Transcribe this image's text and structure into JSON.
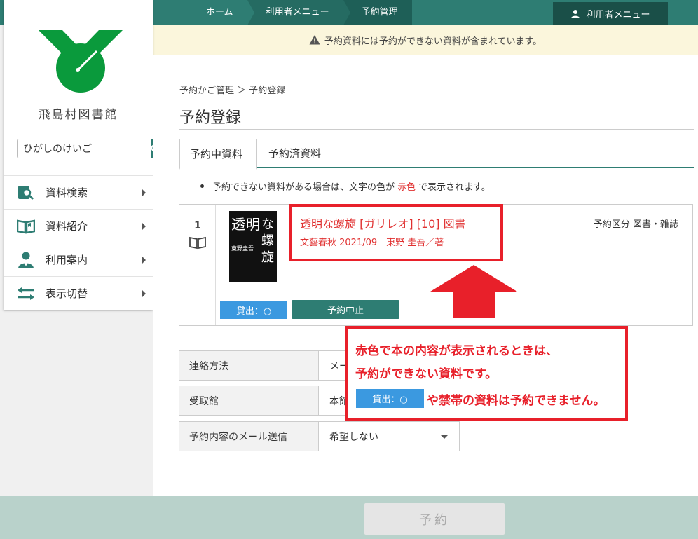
{
  "topbar": {
    "breadcrumbs": [
      "ホーム",
      "利用者メニュー",
      "予約管理"
    ],
    "user_menu_label": "利用者メニュー"
  },
  "warning": {
    "text": "予約資料には予約ができない資料が含まれています。"
  },
  "sidebar": {
    "library_name": "飛島村図書館",
    "search_value": "ひがしのけいご",
    "items": [
      {
        "label": "資料検索",
        "icon": "search-book-icon"
      },
      {
        "label": "資料紹介",
        "icon": "open-book-icon"
      },
      {
        "label": "利用案内",
        "icon": "person-icon"
      },
      {
        "label": "表示切替",
        "icon": "switch-arrows-icon"
      }
    ]
  },
  "main": {
    "breadcrumb": "予約かご管理 ＞ 予約登録",
    "title": "予約登録",
    "tabs": [
      "予約中資料",
      "予約済資料"
    ],
    "note_prefix": "予約できない資料がある場合は、文字の色が",
    "note_red": "赤色",
    "note_suffix": "で表示されます。",
    "item": {
      "number": "1",
      "title": "透明な螺旋 [ガリレオ] [10] 図書",
      "meta": "文藝春秋 2021/09　東野 圭吾／著",
      "kind": "予約区分 図書・雑誌",
      "lend_status": "貸出：○",
      "cancel_label": "予約中止",
      "cover_text": {
        "a": "透",
        "b": "明",
        "c": "な",
        "d": "螺",
        "e": "旋",
        "author": "東野圭吾"
      }
    },
    "form": [
      {
        "label": "連絡方法",
        "value": "メー"
      },
      {
        "label": "受取館",
        "value": "本館"
      },
      {
        "label": "予約内容のメール送信",
        "value": "希望しない"
      }
    ],
    "submit_label": "予約"
  },
  "annotation": {
    "line1": "赤色で本の内容が表示されるときは、",
    "line2": "予約ができない資料です。",
    "line3": "や禁帯の資料は予約できません。",
    "badge": "貸出：○"
  },
  "colors": {
    "brand": "#2e7d73",
    "alert_red": "#e8202a",
    "item_red": "#e03030",
    "badge_blue": "#3b99e0"
  }
}
